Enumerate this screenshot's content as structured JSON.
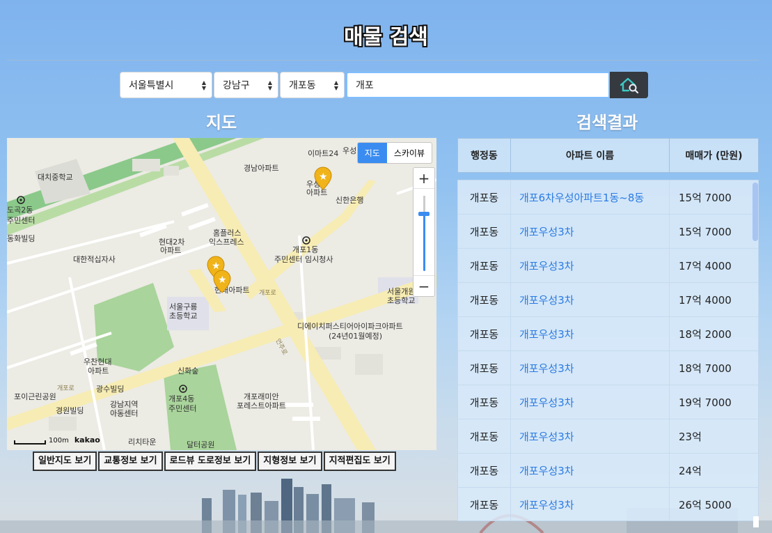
{
  "page": {
    "title": "매물 검색"
  },
  "search": {
    "city": "서울특별시",
    "district": "강남구",
    "dong": "개포동",
    "keyword": "개포",
    "button_icon": "house-search-icon"
  },
  "map_section": {
    "title": "지도",
    "map_type": {
      "map": "지도",
      "skyview": "스카이뷰"
    },
    "zoom": {
      "in": "+",
      "out": "−"
    },
    "scale": {
      "label": "100m",
      "brand": "kakao"
    },
    "labels": {
      "emart24": "이마트24",
      "woosung": "우성",
      "woosung_apt": "아파트",
      "gyeongnam": "경남아파트",
      "daechi_school": "대치중학교",
      "dogok": "도곡2동",
      "dogok_center": "주민센터",
      "donghwa": "동화빌딩",
      "shinhan": "신한은행",
      "homeplus": "홈플러스",
      "homeplus2": "익스프레스",
      "hyundai2": "현대2차",
      "hyundai2b": "아파트",
      "gaepo1": "개포1동",
      "gaepo1_center": "주민센터 임시청사",
      "redcross": "대한적십자사",
      "hyundai_apt": "현대아파트",
      "guryong": "서울구룡",
      "guryong2": "초등학교",
      "gaeil": "서울개원",
      "gaeil2": "초등학교",
      "dh": "디에이치퍼스티어아이파크아파트",
      "dh2": "(24년01월예정)",
      "woochan": "우찬현대",
      "woochan2": "아파트",
      "gwangsu": "광수빌딩",
      "shinhwa": "신화숲",
      "gaepo4": "개포4동",
      "gaepo4_center": "주민센터",
      "poi_park": "포이근린공원",
      "gyeongwon": "경원빌딩",
      "gangnam_child": "강남지역",
      "gangnam_child2": "아동센터",
      "raemian": "개포래미안",
      "raemian2": "포레스트아파트",
      "richitower": "리치타운",
      "dalteo": "달터공원",
      "gaeporo": "개포로",
      "eonjuro": "언주로"
    },
    "buttons": [
      "일반지도 보기",
      "교통정보 보기",
      "로드뷰 도로정보 보기",
      "지형정보 보기",
      "지적편집도 보기"
    ]
  },
  "results": {
    "title": "검색결과",
    "headers": [
      "행정동",
      "아파트 이름",
      "매매가 (만원)"
    ],
    "rows": [
      {
        "dong": "개포동",
        "name": "개포6차우성아파트1동~8동",
        "price": "15억 7000"
      },
      {
        "dong": "개포동",
        "name": "개포우성3차",
        "price": "15억 7000"
      },
      {
        "dong": "개포동",
        "name": "개포우성3차",
        "price": "17억 4000"
      },
      {
        "dong": "개포동",
        "name": "개포우성3차",
        "price": "17억 4000"
      },
      {
        "dong": "개포동",
        "name": "개포우성3차",
        "price": "18억 2000"
      },
      {
        "dong": "개포동",
        "name": "개포우성3차",
        "price": "18억 7000"
      },
      {
        "dong": "개포동",
        "name": "개포우성3차",
        "price": "19억 7000"
      },
      {
        "dong": "개포동",
        "name": "개포우성3차",
        "price": "23억"
      },
      {
        "dong": "개포동",
        "name": "개포우성3차",
        "price": "24억"
      },
      {
        "dong": "개포동",
        "name": "개포우성3차",
        "price": "26억 5000"
      }
    ]
  }
}
